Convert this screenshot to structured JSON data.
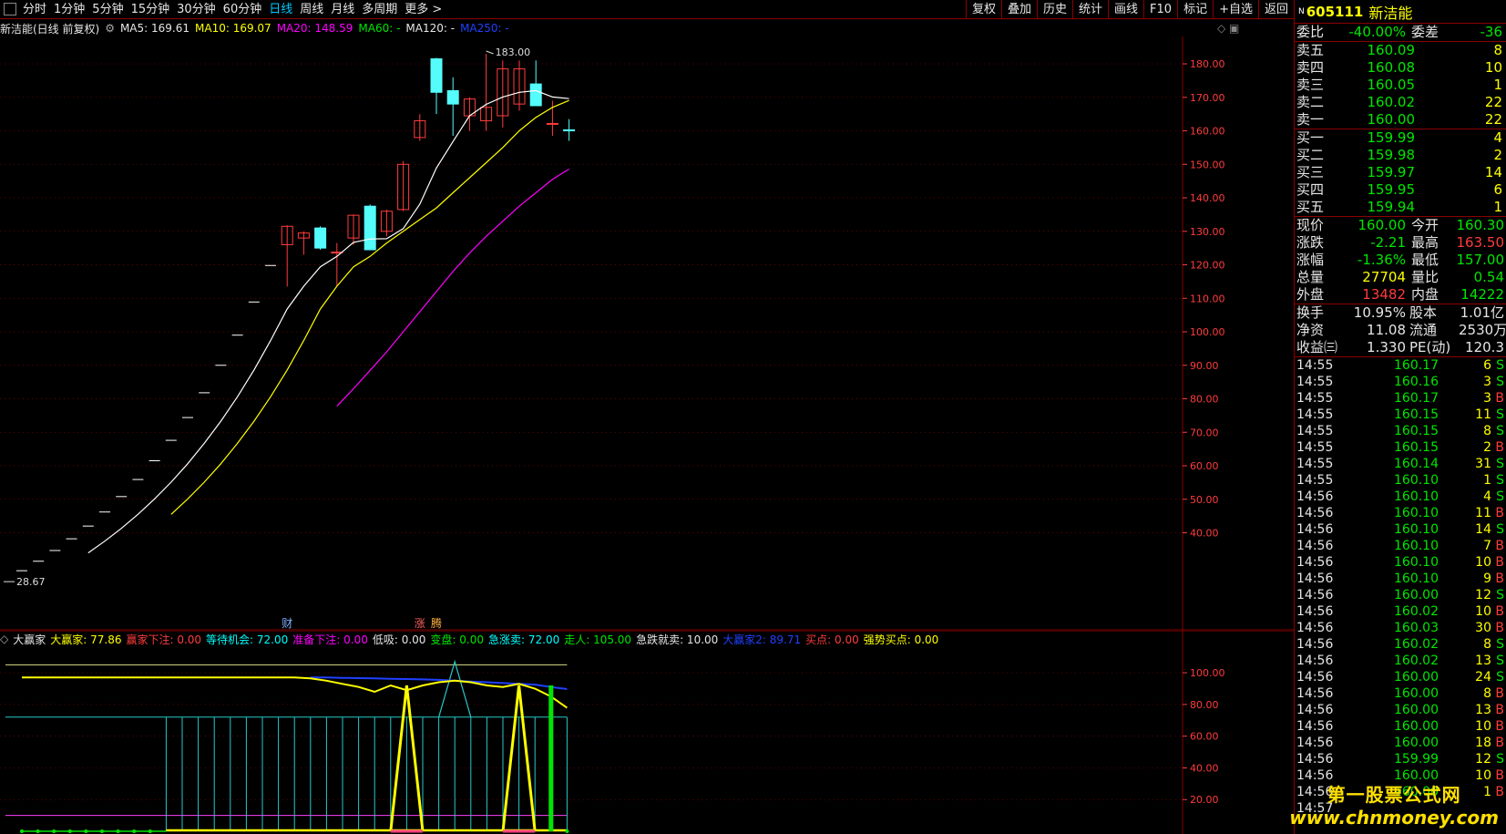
{
  "toolbar": {
    "left": [
      "分时",
      "1分钟",
      "5分钟",
      "15分钟",
      "30分钟",
      "60分钟",
      "日线",
      "周线",
      "月线",
      "多周期",
      "更多 >"
    ],
    "active": "日线",
    "right": [
      "复权",
      "叠加",
      "历史",
      "统计",
      "画线",
      "F10",
      "标记",
      "+自选",
      "返回"
    ]
  },
  "info_bar": {
    "title": "新洁能(日线 前复权)",
    "ma5": "MA5: 169.61",
    "ma10": "MA10: 169.07",
    "ma20": "MA20: 148.59",
    "ma60": "MA60: -",
    "ma120": "MA120: -",
    "ma250": "MA250: -"
  },
  "colors": {
    "up": "#ff3c3c",
    "down": "#54fcfc",
    "ma5": "#ffffff",
    "ma10": "#ffff00",
    "ma20": "#ff00ff",
    "ma60": "#00e600",
    "ma250": "#2040ff",
    "grid": "#8a0000",
    "axis": "#ff3c3c"
  },
  "chart_data": [
    {
      "type": "candlestick",
      "ylim": [
        20,
        186
      ],
      "yticks": [
        "40.00",
        "50.00",
        "60.00",
        "70.00",
        "80.00",
        "90.00",
        "100.00",
        "110.00",
        "120.00",
        "130.00",
        "140.00",
        "150.00",
        "160.00",
        "170.00",
        "180.00"
      ],
      "max_label": "183.00",
      "min_label": "28.67",
      "markers": [
        "财",
        "涨",
        "腾"
      ],
      "candles": [
        {
          "o": 28.67,
          "h": 28.67,
          "l": 28.67,
          "c": 28.67
        },
        {
          "o": 31.5,
          "h": 31.5,
          "l": 31.5,
          "c": 31.5
        },
        {
          "o": 34.7,
          "h": 34.7,
          "l": 34.7,
          "c": 34.7
        },
        {
          "o": 38.2,
          "h": 38.2,
          "l": 38.2,
          "c": 38.2
        },
        {
          "o": 42.0,
          "h": 42.0,
          "l": 42.0,
          "c": 42.0
        },
        {
          "o": 46.2,
          "h": 46.2,
          "l": 46.2,
          "c": 46.2
        },
        {
          "o": 50.8,
          "h": 50.8,
          "l": 50.8,
          "c": 50.8
        },
        {
          "o": 55.9,
          "h": 55.9,
          "l": 55.9,
          "c": 55.9
        },
        {
          "o": 61.5,
          "h": 61.5,
          "l": 61.5,
          "c": 61.5
        },
        {
          "o": 67.6,
          "h": 67.6,
          "l": 67.6,
          "c": 67.6
        },
        {
          "o": 74.4,
          "h": 74.4,
          "l": 74.4,
          "c": 74.4
        },
        {
          "o": 81.8,
          "h": 81.8,
          "l": 81.8,
          "c": 81.8
        },
        {
          "o": 90.0,
          "h": 90.0,
          "l": 90.0,
          "c": 90.0
        },
        {
          "o": 99.0,
          "h": 99.0,
          "l": 99.0,
          "c": 99.0
        },
        {
          "o": 108.9,
          "h": 108.9,
          "l": 108.9,
          "c": 108.9
        },
        {
          "o": 119.8,
          "h": 119.8,
          "l": 119.8,
          "c": 119.8
        },
        {
          "o": 126.0,
          "h": 131.8,
          "l": 113.5,
          "c": 131.5
        },
        {
          "o": 128.0,
          "h": 130.0,
          "l": 123.0,
          "c": 129.5
        },
        {
          "o": 131.0,
          "h": 131.5,
          "l": 124.5,
          "c": 125.0
        },
        {
          "o": 123.8,
          "h": 126.5,
          "l": 113.5,
          "c": 123.8
        },
        {
          "o": 128.0,
          "h": 135.0,
          "l": 126.0,
          "c": 134.8
        },
        {
          "o": 137.5,
          "h": 138.0,
          "l": 124.5,
          "c": 124.5
        },
        {
          "o": 130.0,
          "h": 136.5,
          "l": 128.5,
          "c": 136.0
        },
        {
          "o": 136.5,
          "h": 151.0,
          "l": 136.0,
          "c": 150.0
        },
        {
          "o": 158.0,
          "h": 165.0,
          "l": 157.0,
          "c": 163.0
        },
        {
          "o": 181.5,
          "h": 181.8,
          "l": 165.0,
          "c": 171.5
        },
        {
          "o": 172.0,
          "h": 176.0,
          "l": 158.5,
          "c": 168.0
        },
        {
          "o": 164.5,
          "h": 170.0,
          "l": 160.0,
          "c": 169.5
        },
        {
          "o": 163.0,
          "h": 183.0,
          "l": 160.0,
          "c": 167.0
        },
        {
          "o": 164.5,
          "h": 181.0,
          "l": 161.0,
          "c": 178.5
        },
        {
          "o": 168.0,
          "h": 181.0,
          "l": 166.0,
          "c": 178.5
        },
        {
          "o": 174.0,
          "h": 181.0,
          "l": 167.5,
          "c": 167.5
        },
        {
          "o": 162.21,
          "h": 169.0,
          "l": 158.5,
          "c": 162.21
        },
        {
          "o": 160.3,
          "h": 163.5,
          "l": 157.0,
          "c": 160.0
        }
      ],
      "ma5": [
        null,
        null,
        null,
        null,
        34.0,
        37.5,
        41.3,
        45.5,
        50.1,
        55.1,
        60.6,
        66.7,
        73.3,
        80.6,
        88.6,
        97.4,
        106.8,
        113.6,
        119.4,
        122.5,
        126.7,
        127.7,
        127.8,
        130.8,
        138.1,
        148.9,
        156.8,
        164.5,
        167.9,
        170.1,
        171.5,
        172.0,
        170.1,
        169.61
      ],
      "ma10": [
        null,
        null,
        null,
        null,
        null,
        null,
        null,
        null,
        null,
        45.5,
        50.1,
        55.1,
        60.6,
        66.7,
        73.3,
        80.6,
        88.6,
        97.4,
        106.8,
        113.6,
        119.4,
        122.5,
        126.5,
        130.0,
        133.5,
        137.0,
        141.5,
        146.0,
        150.5,
        155.0,
        160.0,
        164.0,
        167.0,
        169.07
      ],
      "ma20": [
        null,
        null,
        null,
        null,
        null,
        null,
        null,
        null,
        null,
        null,
        null,
        null,
        null,
        null,
        null,
        null,
        null,
        null,
        null,
        77.8,
        83.0,
        88.5,
        94.0,
        100.0,
        106.0,
        112.0,
        118.0,
        123.5,
        128.5,
        133.0,
        137.5,
        141.5,
        145.5,
        148.59
      ]
    },
    {
      "type": "line",
      "title": "大赢家",
      "legend": [
        {
          "name": "大赢家",
          "value": "77.86"
        },
        {
          "name": "赢家下注",
          "value": "0.00"
        },
        {
          "name": "等待机会",
          "value": "72.00"
        },
        {
          "name": "准备下注",
          "value": "0.00"
        },
        {
          "name": "低吸",
          "value": "0.00"
        },
        {
          "name": "变盘",
          "value": "0.00"
        },
        {
          "name": "急涨卖",
          "value": "72.00"
        },
        {
          "name": "走人",
          "value": "105.00"
        },
        {
          "name": "急跌就卖",
          "value": "10.00"
        },
        {
          "name": "大赢家2",
          "value": "89.71"
        },
        {
          "name": "买点",
          "value": "0.00"
        },
        {
          "name": "强势买点",
          "value": "0.00"
        }
      ],
      "ylim": [
        0,
        115
      ],
      "yticks": [
        "20.00",
        "40.00",
        "60.00",
        "80.00",
        "100.00"
      ],
      "dayingjia": [
        97,
        97,
        97,
        97,
        97,
        97,
        97,
        97,
        97,
        97,
        97,
        97,
        97,
        97,
        97,
        97,
        97,
        97,
        96.5,
        95,
        93,
        91,
        88,
        92,
        89,
        92,
        94,
        95,
        94,
        92,
        91,
        93,
        90,
        85,
        77.86
      ],
      "dayingjia2": [
        null,
        null,
        null,
        null,
        null,
        null,
        null,
        null,
        null,
        null,
        null,
        null,
        null,
        null,
        null,
        null,
        null,
        null,
        97,
        97,
        96.8,
        96.6,
        96.4,
        96.2,
        96,
        95.8,
        95.5,
        95,
        94.5,
        94,
        93.5,
        93,
        92.5,
        91,
        89.71
      ],
      "spikes_yellow": [
        24,
        31
      ],
      "spike_cyan_index": 27,
      "green_bar_index": 33
    }
  ],
  "sub_info": {
    "prefix": "大赢家"
  },
  "panel": {
    "code": "605111",
    "name": "新洁能",
    "weibi": {
      "label": "委比",
      "value": "-40.00%",
      "label2": "委差",
      "value2": "-36"
    },
    "sells": [
      {
        "label": "卖五",
        "price": "160.09",
        "vol": "8"
      },
      {
        "label": "卖四",
        "price": "160.08",
        "vol": "10"
      },
      {
        "label": "卖三",
        "price": "160.05",
        "vol": "1"
      },
      {
        "label": "卖二",
        "price": "160.02",
        "vol": "22"
      },
      {
        "label": "卖一",
        "price": "160.00",
        "vol": "22"
      }
    ],
    "buys": [
      {
        "label": "买一",
        "price": "159.99",
        "vol": "4"
      },
      {
        "label": "买二",
        "price": "159.98",
        "vol": "2"
      },
      {
        "label": "买三",
        "price": "159.97",
        "vol": "14"
      },
      {
        "label": "买四",
        "price": "159.95",
        "vol": "6"
      },
      {
        "label": "买五",
        "price": "159.94",
        "vol": "1"
      }
    ],
    "quote": [
      {
        "l1": "现价",
        "v1": "160.00",
        "c1": "green",
        "l2": "今开",
        "v2": "160.30",
        "c2": "green"
      },
      {
        "l1": "涨跌",
        "v1": "-2.21",
        "c1": "green",
        "l2": "最高",
        "v2": "163.50",
        "c2": "red"
      },
      {
        "l1": "涨幅",
        "v1": "-1.36%",
        "c1": "green",
        "l2": "最低",
        "v2": "157.00",
        "c2": "green"
      },
      {
        "l1": "总量",
        "v1": "27704",
        "c1": "yellow",
        "l2": "量比",
        "v2": "0.54",
        "c2": "green"
      },
      {
        "l1": "外盘",
        "v1": "13482",
        "c1": "red",
        "l2": "内盘",
        "v2": "14222",
        "c2": "green"
      }
    ],
    "fund": [
      {
        "l1": "换手",
        "v1": "10.95%",
        "l2": "股本",
        "v2": "1.01亿"
      },
      {
        "l1": "净资",
        "v1": "11.08",
        "l2": "流通",
        "v2": "2530万"
      },
      {
        "l1": "收益㈢",
        "v1": "1.330",
        "l2": "PE(动)",
        "v2": "120.3"
      }
    ],
    "ticks": [
      {
        "t": "14:55",
        "p": "160.17",
        "v": "6",
        "bs": "S"
      },
      {
        "t": "14:55",
        "p": "160.16",
        "v": "3",
        "bs": "S"
      },
      {
        "t": "14:55",
        "p": "160.17",
        "v": "3",
        "bs": "B"
      },
      {
        "t": "14:55",
        "p": "160.15",
        "v": "11",
        "bs": "S"
      },
      {
        "t": "14:55",
        "p": "160.15",
        "v": "8",
        "bs": "S"
      },
      {
        "t": "14:55",
        "p": "160.15",
        "v": "2",
        "bs": "B"
      },
      {
        "t": "14:55",
        "p": "160.14",
        "v": "31",
        "bs": "S"
      },
      {
        "t": "14:55",
        "p": "160.10",
        "v": "1",
        "bs": "S"
      },
      {
        "t": "14:56",
        "p": "160.10",
        "v": "4",
        "bs": "S"
      },
      {
        "t": "14:56",
        "p": "160.10",
        "v": "11",
        "bs": "B"
      },
      {
        "t": "14:56",
        "p": "160.10",
        "v": "14",
        "bs": "S"
      },
      {
        "t": "14:56",
        "p": "160.10",
        "v": "7",
        "bs": "B"
      },
      {
        "t": "14:56",
        "p": "160.10",
        "v": "10",
        "bs": "B"
      },
      {
        "t": "14:56",
        "p": "160.10",
        "v": "9",
        "bs": "B"
      },
      {
        "t": "14:56",
        "p": "160.00",
        "v": "12",
        "bs": "S"
      },
      {
        "t": "14:56",
        "p": "160.02",
        "v": "10",
        "bs": "B"
      },
      {
        "t": "14:56",
        "p": "160.03",
        "v": "30",
        "bs": "B"
      },
      {
        "t": "14:56",
        "p": "160.02",
        "v": "8",
        "bs": "S"
      },
      {
        "t": "14:56",
        "p": "160.02",
        "v": "13",
        "bs": "S"
      },
      {
        "t": "14:56",
        "p": "160.00",
        "v": "24",
        "bs": "S"
      },
      {
        "t": "14:56",
        "p": "160.00",
        "v": "8",
        "bs": "B"
      },
      {
        "t": "14:56",
        "p": "160.00",
        "v": "13",
        "bs": "B"
      },
      {
        "t": "14:56",
        "p": "160.00",
        "v": "10",
        "bs": "B"
      },
      {
        "t": "14:56",
        "p": "160.00",
        "v": "18",
        "bs": "B"
      },
      {
        "t": "14:56",
        "p": "159.99",
        "v": "12",
        "bs": "S"
      },
      {
        "t": "14:56",
        "p": "160.00",
        "v": "10",
        "bs": "B"
      },
      {
        "t": "14:56",
        "p": "160.00",
        "v": "1",
        "bs": "B"
      },
      {
        "t": "14:57",
        "p": "",
        "v": "",
        "bs": ""
      }
    ]
  },
  "watermark": {
    "line1": "第一股票公式网",
    "line2": "www.chnmoney.com"
  }
}
